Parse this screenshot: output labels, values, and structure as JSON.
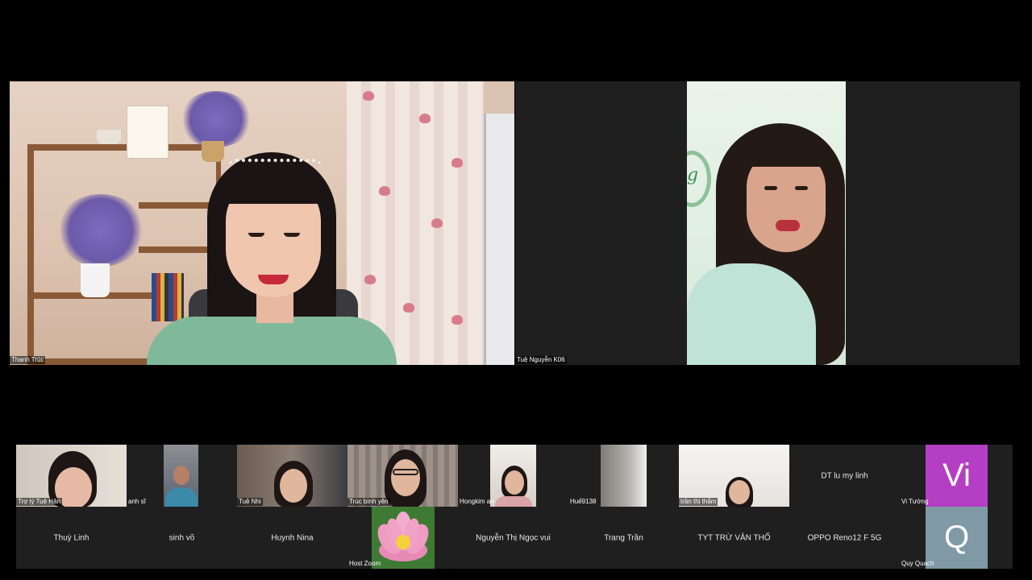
{
  "speakers": [
    {
      "name": "Thanh Trúc"
    },
    {
      "name": "Tuệ Nguyễn K06"
    }
  ],
  "gallery": {
    "row1": [
      {
        "name": "Trợ lý Tuệ Hân",
        "video": true
      },
      {
        "name": "anh sĩ",
        "video": true
      },
      {
        "name": "Tuệ Nhi",
        "video": true
      },
      {
        "name": "Trúc bình yên",
        "video": true
      },
      {
        "name": "Hongkim an",
        "video": true
      },
      {
        "name": "Huế9138",
        "video": true
      },
      {
        "name": "trần thị thắm",
        "video": true
      },
      {
        "name": "DT lu my linh",
        "video": false
      },
      {
        "name": "Vi Tường",
        "avatar_letter": "Vi",
        "avatar_color": "#b53fc4"
      }
    ],
    "row2": [
      {
        "name": "Thuỳ Linh",
        "video": false
      },
      {
        "name": "sinh võ",
        "video": false
      },
      {
        "name": "Huynh Nina",
        "video": false
      },
      {
        "name": "Host Zoom",
        "video": true
      },
      {
        "name": "Nguyễn Thị Ngọc vui",
        "video": false
      },
      {
        "name": "Trang Trần",
        "video": false
      },
      {
        "name": "TYT TRỪ VĂN THỐ",
        "video": false
      },
      {
        "name": "OPPO Reno12 F 5G",
        "video": false
      },
      {
        "name": "Quy Quach",
        "avatar_letter": "Q",
        "avatar_color": "#7f9aa5"
      }
    ]
  },
  "colors": {
    "background": "#000000",
    "tile": "#1f1f1f"
  }
}
